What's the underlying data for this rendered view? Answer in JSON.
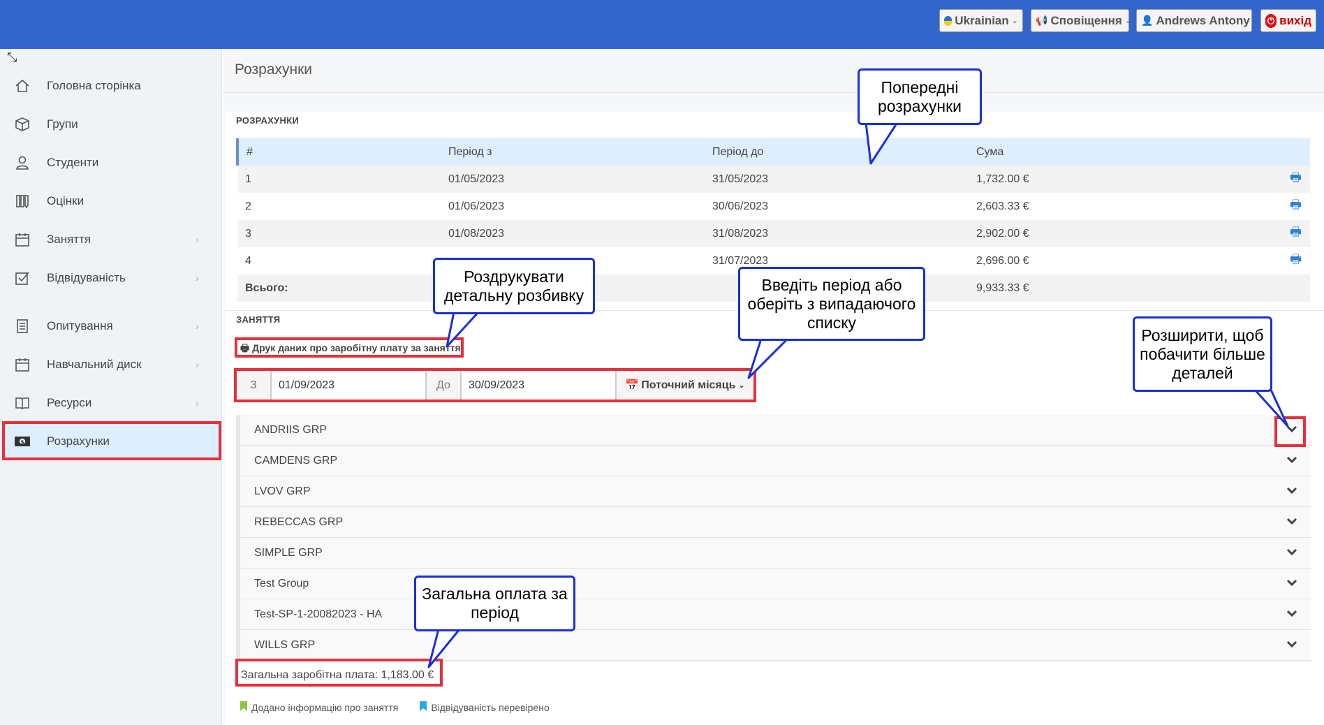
{
  "topbar": {
    "language": "Ukrainian",
    "notifications": "Сповіщення",
    "user": "Andrews Antony",
    "logout": "вихід"
  },
  "sidebar": {
    "items": [
      {
        "label": "Головна сторінка",
        "icon": "home-icon",
        "chevron": false
      },
      {
        "label": "Групи",
        "icon": "cube-icon",
        "chevron": false
      },
      {
        "label": "Студенти",
        "icon": "user-icon",
        "chevron": false
      },
      {
        "label": "Оцінки",
        "icon": "grades-icon",
        "chevron": false
      },
      {
        "label": "Заняття",
        "icon": "calendar-icon",
        "chevron": true
      },
      {
        "label": "Відвідуваність",
        "icon": "checkbox-icon",
        "chevron": true
      },
      {
        "label": "Опитування",
        "icon": "survey-icon",
        "chevron": true
      },
      {
        "label": "Навчальний диск",
        "icon": "calendar-icon",
        "chevron": true
      },
      {
        "label": "Ресурси",
        "icon": "book-icon",
        "chevron": true
      },
      {
        "label": "Розрахунки",
        "icon": "money-icon",
        "chevron": false,
        "active": true
      }
    ]
  },
  "page": {
    "title": "Розрахунки"
  },
  "calculations": {
    "section_label": "РОЗРАХУНКИ",
    "headers": [
      "#",
      "Період з",
      "Період до",
      "Сума"
    ],
    "rows": [
      {
        "n": "1",
        "from": "01/05/2023",
        "to": "31/05/2023",
        "sum": "1,732.00 €"
      },
      {
        "n": "2",
        "from": "01/06/2023",
        "to": "30/06/2023",
        "sum": "2,603.33 €"
      },
      {
        "n": "3",
        "from": "01/08/2023",
        "to": "31/08/2023",
        "sum": "2,902.00 €"
      },
      {
        "n": "4",
        "from": "",
        "to": "31/07/2023",
        "sum": "2,696.00 €"
      }
    ],
    "total_label": "Всього:",
    "total_value": "9,933.33 €"
  },
  "lessons": {
    "section_label": "ЗАНЯТТЯ",
    "print_link": "Друк даних про заробітну плату за заняття",
    "from_label": "З",
    "from_value": "01/09/2023",
    "to_label": "До",
    "to_value": "30/09/2023",
    "period_dropdown": "Поточний місяць",
    "groups": [
      "ANDRIIS GRP",
      "CAMDENS GRP",
      "LVOV GRP",
      "REBECCAS GRP",
      "SIMPLE GRP",
      "Test Group",
      "Test-SP-1-20082023 - HA",
      "WILLS GRP"
    ],
    "total_salary": "Загальна заробітна плата: 1,183.00 €",
    "legend": [
      {
        "label": "Додано інформацію про заняття",
        "color": "#8dc63f"
      },
      {
        "label": "Відвідуваність перевірено",
        "color": "#29a8e0"
      }
    ]
  },
  "callouts": {
    "previous": "Попередні розрахунки",
    "print": "Роздрукувати детальну розбивку",
    "period": "Введіть період або оберіть з випадаючого списку",
    "expand": "Розширити, щоб побачити більше деталей",
    "total": "Загальна оплата за період"
  },
  "colors": {
    "topbar": "#3266cc",
    "callout_border": "#1a2fd6",
    "highlight": "#e8303a",
    "print_icon": "#2a7fd8"
  }
}
